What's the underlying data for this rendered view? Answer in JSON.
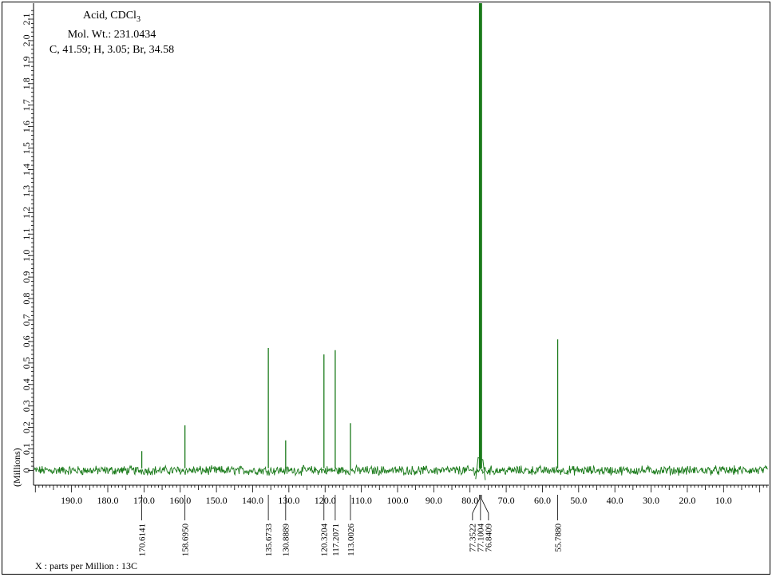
{
  "chart_data": {
    "type": "line",
    "annotation": {
      "compound": "Acid, CDCl",
      "compound_subscript": "3",
      "mol_wt": "Mol. Wt.: 231.0434",
      "composition": "C, 41.59; H, 3.05; Br, 34.58"
    },
    "xlabel": "X : parts per Million : 13C",
    "ylabel": "(Millions)",
    "xlim": [
      200.5,
      -2.5
    ],
    "ylim": [
      -0.05,
      2.15
    ],
    "x_ticks": [
      190.0,
      180.0,
      170.0,
      160.0,
      150.0,
      140.0,
      130.0,
      120.0,
      110.0,
      100.0,
      90.0,
      80.0,
      70.0,
      60.0,
      50.0,
      40.0,
      30.0,
      20.0,
      10.0
    ],
    "x_tick_labels": [
      "190.0",
      "180.0",
      "170.0",
      "160.0",
      "150.0",
      "140.0",
      "130.0",
      "120.0",
      "110.0",
      "100.0",
      "90.0",
      "80.0",
      "70.0",
      "60.0",
      "50.0",
      "40.0",
      "30.0",
      "20.0",
      "10.0"
    ],
    "y_ticks": [
      0,
      0.1,
      0.2,
      0.3,
      0.4,
      0.5,
      0.6,
      0.7,
      0.8,
      0.9,
      1.0,
      1.1,
      1.2,
      1.3,
      1.4,
      1.5,
      1.6,
      1.7,
      1.8,
      1.9,
      2.0,
      2.1
    ],
    "y_tick_labels": [
      "0",
      "0.1",
      "0.2",
      "0.3",
      "0.4",
      "0.5",
      "0.6",
      "0.7",
      "0.8",
      "0.9",
      "1.0",
      "1.1",
      "1.2",
      "1.3",
      "1.4",
      "1.5",
      "1.6",
      "1.7",
      "1.8",
      "1.9",
      "2.0",
      "2.1"
    ],
    "series": [
      {
        "color": "#1a7a1a",
        "peaks": [
          {
            "x": 170.6141,
            "y": 0.09,
            "label": "170.6141"
          },
          {
            "x": 158.695,
            "y": 0.21,
            "label": "158.6950"
          },
          {
            "x": 135.6733,
            "y": 0.57,
            "label": "135.6733"
          },
          {
            "x": 130.8889,
            "y": 0.14,
            "label": "130.8889"
          },
          {
            "x": 120.3204,
            "y": 0.54,
            "label": "120.3204"
          },
          {
            "x": 117.2071,
            "y": 0.56,
            "label": "117.2071"
          },
          {
            "x": 113.0026,
            "y": 0.22,
            "label": "113.0026"
          },
          {
            "x": 77.3522,
            "y": 2.2,
            "label": "77.3522"
          },
          {
            "x": 77.1004,
            "y": 2.2,
            "label": "77.1004"
          },
          {
            "x": 76.8409,
            "y": 2.2,
            "label": "76.8409"
          },
          {
            "x": 55.788,
            "y": 0.61,
            "label": "55.7880"
          }
        ]
      }
    ]
  }
}
